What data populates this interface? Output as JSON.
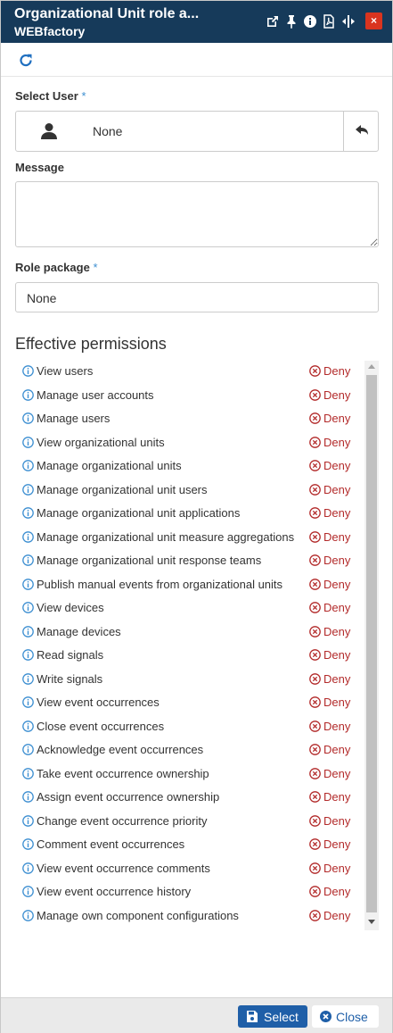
{
  "header": {
    "title": "Organizational Unit role a...",
    "subtitle": "WEBfactory",
    "icons": [
      "external-link-icon",
      "pin-icon",
      "info-icon",
      "pdf-icon",
      "resize-icon"
    ],
    "close_label": "×"
  },
  "toolbar": {
    "refresh_icon": "refresh-icon"
  },
  "form": {
    "select_user_label": "Select User",
    "required_mark": "*",
    "user_value": "None",
    "message_label": "Message",
    "message_value": "",
    "role_package_label": "Role package",
    "role_package_value": "None"
  },
  "permissions": {
    "title": "Effective permissions",
    "deny_label": "Deny",
    "items": [
      "View users",
      "Manage user accounts",
      "Manage users",
      "View organizational units",
      "Manage organizational units",
      "Manage organizational unit users",
      "Manage organizational unit applications",
      "Manage organizational unit measure aggregations",
      "Manage organizational unit response teams",
      "Publish manual events from organizational units",
      "View devices",
      "Manage devices",
      "Read signals",
      "Write signals",
      "View event occurrences",
      "Close event occurrences",
      "Acknowledge event occurrences",
      "Take event occurrence ownership",
      "Assign event occurrence ownership",
      "Change event occurrence priority",
      "Comment event occurrences",
      "View event occurrence comments",
      "View event occurrence history",
      "Manage own component configurations"
    ]
  },
  "footer": {
    "select_label": "Select",
    "close_label": "Close"
  },
  "colors": {
    "header_bg": "#163a5a",
    "accent": "#1f5fa8",
    "deny": "#b32b2b",
    "info": "#3d8fd1",
    "close_red": "#d9341f"
  }
}
